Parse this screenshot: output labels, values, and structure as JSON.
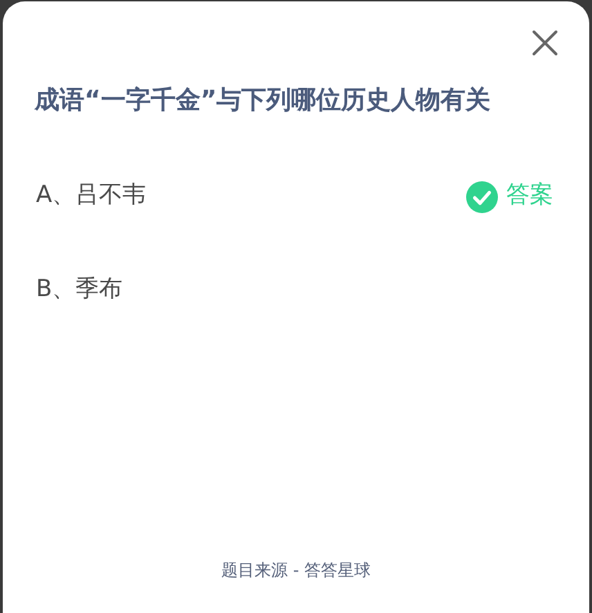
{
  "question": {
    "title": "成语“一字千金”与下列哪位历史人物有关"
  },
  "options": [
    {
      "label": "A、吕不韦",
      "is_answer": true,
      "answer_label": "答案"
    },
    {
      "label": "B、季布",
      "is_answer": false
    }
  ],
  "footer": "题目来源 - 答答星球"
}
